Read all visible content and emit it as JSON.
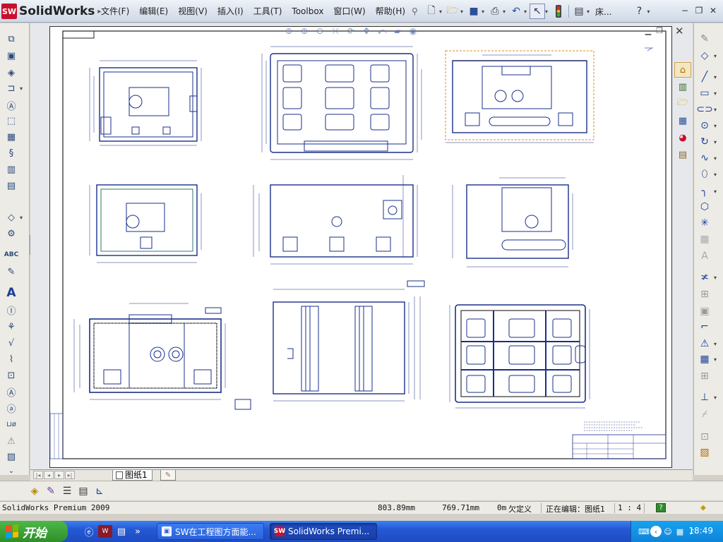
{
  "app": {
    "brand": "SolidWorks",
    "logo_badge": "SW"
  },
  "menu": [
    "文件(F)",
    "编辑(E)",
    "视图(V)",
    "插入(I)",
    "工具(T)",
    "Toolbox",
    "窗口(W)",
    "帮助(H)"
  ],
  "toolbar_top": {
    "search_label": "床...",
    "help_glyph": "?"
  },
  "sheet": {
    "tab_label": "图纸1"
  },
  "status": {
    "product": "SolidWorks Premium 2009",
    "x": "803.89mm",
    "y": "769.71mm",
    "z": "0m",
    "definition": "欠定义",
    "editing": "正在编辑：图纸1",
    "scale": "1 : 4",
    "help_mark": "?"
  },
  "taskbar": {
    "start_label": "开始",
    "buttons": [
      "SW在工程图方面能...",
      "SolidWorks Premi..."
    ],
    "clock": "18:49"
  },
  "colors": {
    "accent_red": "#c8102e",
    "drawing_blue": "#1a2f8a",
    "selection_orange": "#e28a1a",
    "taskbar_blue": "#2458d4",
    "start_green": "#3aa636"
  }
}
